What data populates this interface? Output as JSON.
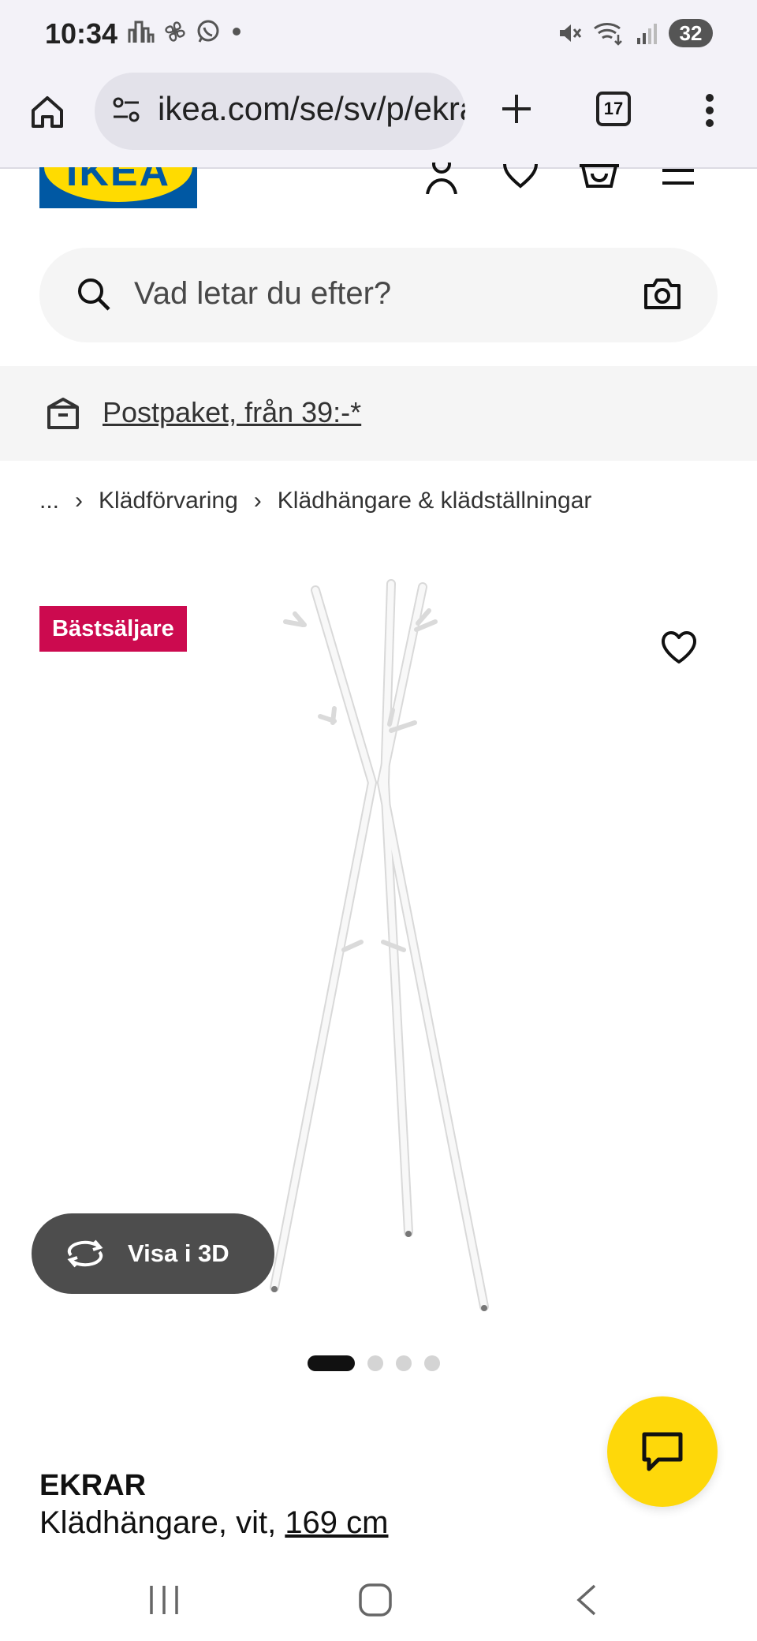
{
  "status_bar": {
    "time": "10:34",
    "battery": "32"
  },
  "browser": {
    "url": "ikea.com/se/sv/p/ekrar",
    "tab_count": "17"
  },
  "header": {
    "logo_text": "IKEA",
    "brand_colors": {
      "blue": "#0058a3",
      "yellow": "#ffdb00"
    }
  },
  "search": {
    "placeholder": "Vad letar du efter?"
  },
  "banner": {
    "text": "Postpaket, från 39:-*"
  },
  "breadcrumb": {
    "items": [
      "...",
      "Klädförvaring",
      "Klädhängare & klädställningar"
    ]
  },
  "product": {
    "badge": "Bästsäljare",
    "badge_color": "#cc0a4f",
    "view_3d_label": "Visa i 3D",
    "image_count": 4,
    "active_image": 1,
    "name": "EKRAR",
    "description": "Klädhängare, vit, ",
    "size": "169 cm"
  },
  "chat": {
    "color": "#fed80a"
  }
}
